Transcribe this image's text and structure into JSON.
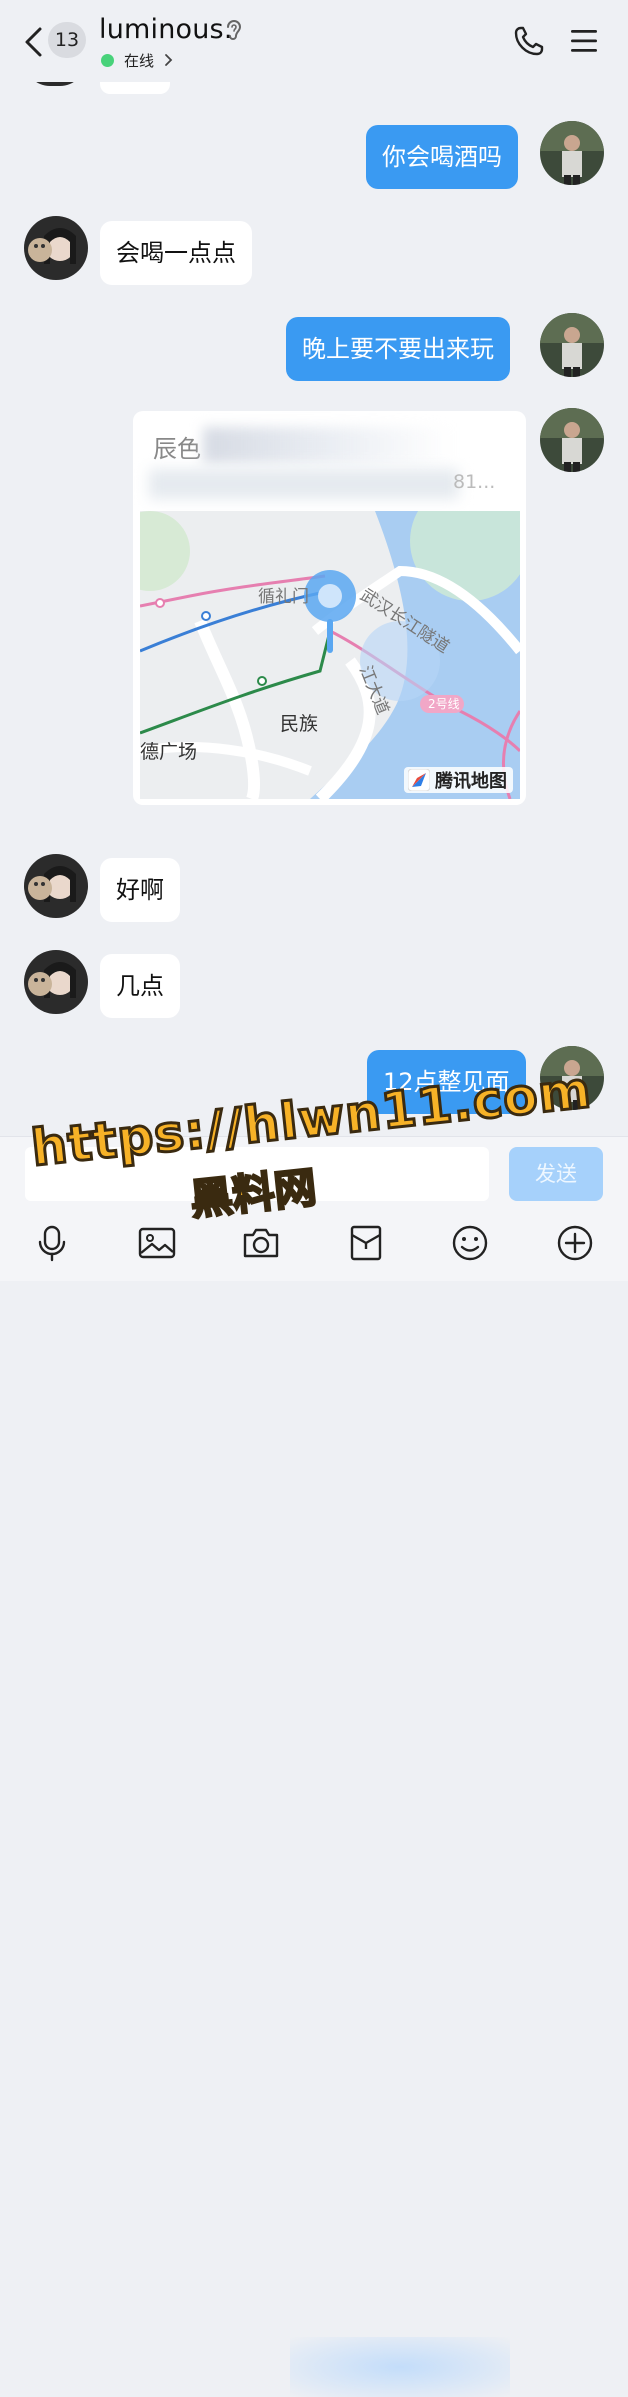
{
  "header": {
    "unread_count": "13",
    "contact_name": "luminous.",
    "status": "在线"
  },
  "messages": [
    {
      "side": "out",
      "text": "你会喝酒吗"
    },
    {
      "side": "in",
      "text": "会喝一点点"
    },
    {
      "side": "out",
      "text": "晚上要不要出来玩"
    },
    {
      "side": "out",
      "type": "location"
    },
    {
      "side": "in",
      "text": "好啊"
    },
    {
      "side": "in",
      "text": "几点"
    },
    {
      "side": "out",
      "text": "12点整见面"
    }
  ],
  "map_card": {
    "title_visible": "辰色",
    "address_tail": "81...",
    "labels": {
      "xunli": "循礼门",
      "wuhan_tunnel": "武汉长江隧道",
      "jiangda": "江大道",
      "minzu": "民族",
      "deguangchang": "德广场",
      "line2": "2号线"
    },
    "provider": "腾讯地图"
  },
  "input_bar": {
    "placeholder": "",
    "send_label": "发送",
    "tools": [
      "microphone-icon",
      "image-icon",
      "camera-icon",
      "red-packet-icon",
      "emoji-icon",
      "plus-icon"
    ]
  },
  "watermark": {
    "url": "https://hlwn11.com",
    "caption": "黑料网"
  },
  "colors": {
    "accent": "#3a9af2",
    "online": "#48d27a",
    "background": "#eef0f4"
  }
}
